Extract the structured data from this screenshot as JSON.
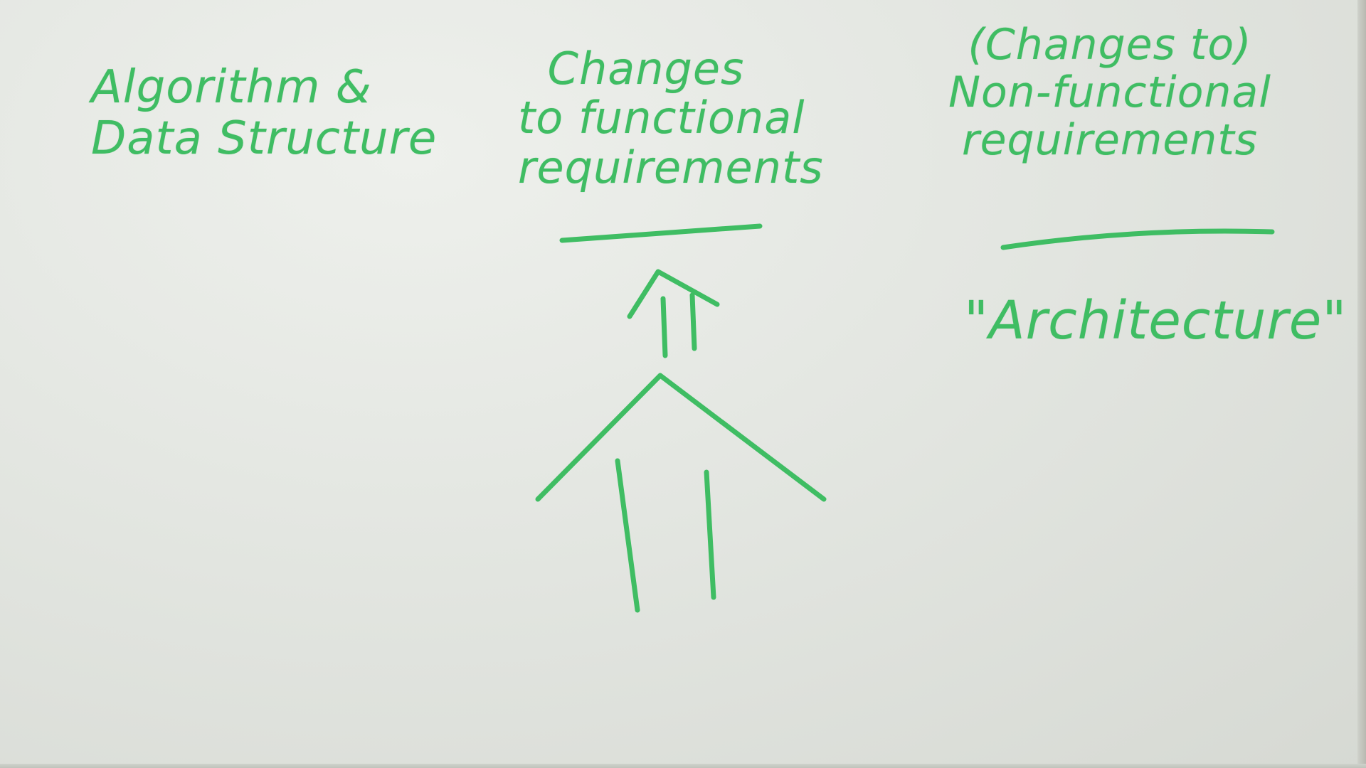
{
  "board": {
    "marker_color": "#3fbd63",
    "background": "#e3e6e1"
  },
  "left_column": {
    "line1": "Algorithm &",
    "line2": "Data Structure"
  },
  "middle_column": {
    "line1": "Changes",
    "line2": "to functional",
    "line3": "requirements"
  },
  "right_column": {
    "line1": "(Changes to)",
    "line2": "Non-functional",
    "line3": "requirements"
  },
  "architecture_label": "\"Architecture\""
}
